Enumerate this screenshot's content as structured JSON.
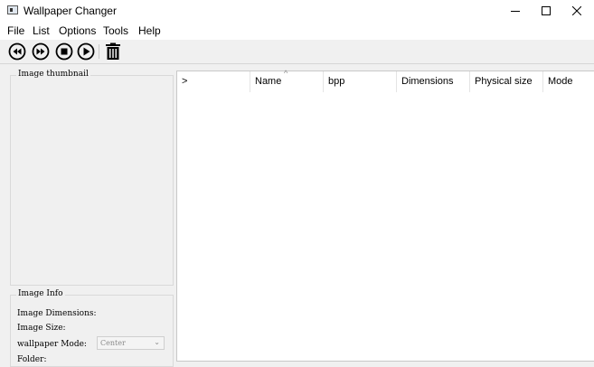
{
  "window": {
    "title": "Wallpaper Changer",
    "minimize_icon": "minimize-icon",
    "maximize_icon": "maximize-icon",
    "close_icon": "close-icon"
  },
  "menu": {
    "items": [
      "File",
      "List",
      "Options",
      "Tools",
      "Help"
    ]
  },
  "toolbar": {
    "buttons": [
      {
        "icon": "rewind-icon"
      },
      {
        "icon": "fast-forward-icon"
      },
      {
        "icon": "stop-icon"
      },
      {
        "icon": "play-icon"
      },
      {
        "icon": "trash-icon"
      }
    ]
  },
  "left_panel": {
    "thumbnail_group_title": "Image thumbnail",
    "info_group_title": "Image Info",
    "dimensions_label": "Image Dimensions:",
    "size_label": "Image Size:",
    "mode_label": "wallpaper Mode:",
    "mode_value": "Center",
    "folder_label": "Folder:"
  },
  "list": {
    "columns": [
      ">",
      "Name",
      "bpp",
      "Dimensions",
      "Physical size",
      "Mode"
    ],
    "sort_indicator": "^"
  },
  "colors": {
    "background": "#f0f0f0",
    "list_background": "#ffffff"
  }
}
